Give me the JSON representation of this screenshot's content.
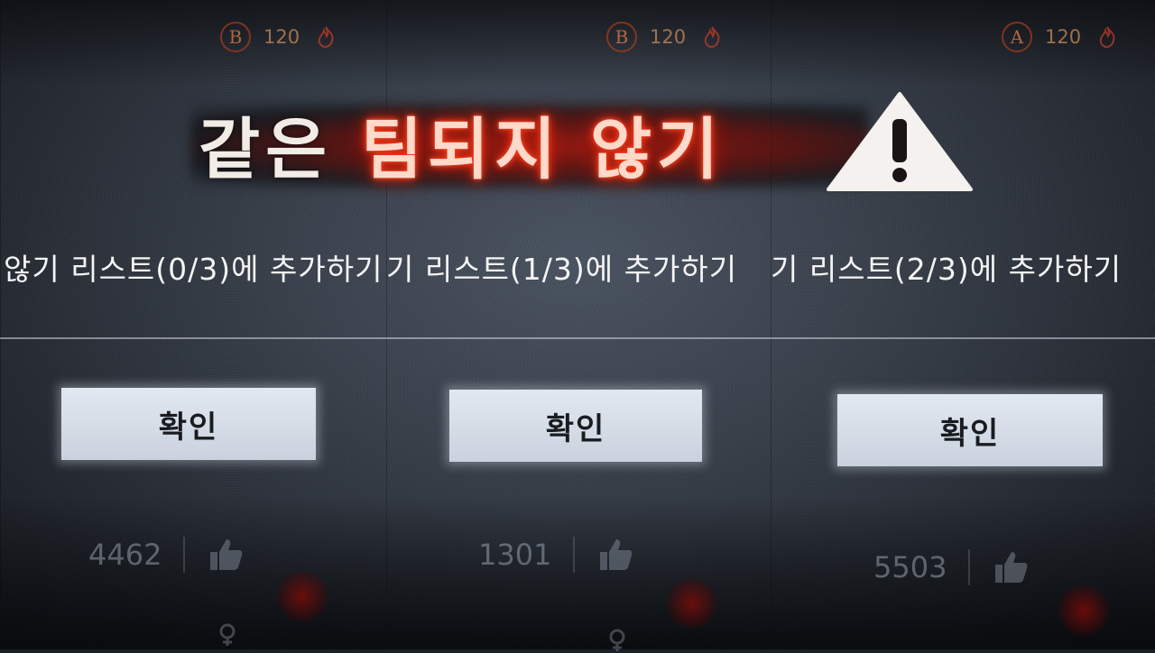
{
  "title": {
    "white_part": "같은 ",
    "red_part": "팀되지 않기"
  },
  "panels": [
    {
      "grade": "B",
      "grade_value": "120",
      "subtitle": "않기 리스트(0/3)에 추가하기",
      "confirm_label": "확인",
      "like_count": "4462"
    },
    {
      "grade": "B",
      "grade_value": "120",
      "subtitle": "기 리스트(1/3)에 추가하기",
      "confirm_label": "확인",
      "like_count": "1301"
    },
    {
      "grade": "A",
      "grade_value": "120",
      "subtitle": "기 리스트(2/3)에 추가하기",
      "confirm_label": "확인",
      "like_count": "5503"
    }
  ],
  "icons": {
    "grade": "grade-emblem-icon",
    "flame": "flame-icon",
    "warning": "warning-triangle-icon",
    "like": "thumbs-up-icon",
    "gender": "gender-icon"
  },
  "colors": {
    "title_glow": "#d41e08",
    "button_bg": "#d6dde7",
    "background": "#3a414c"
  }
}
